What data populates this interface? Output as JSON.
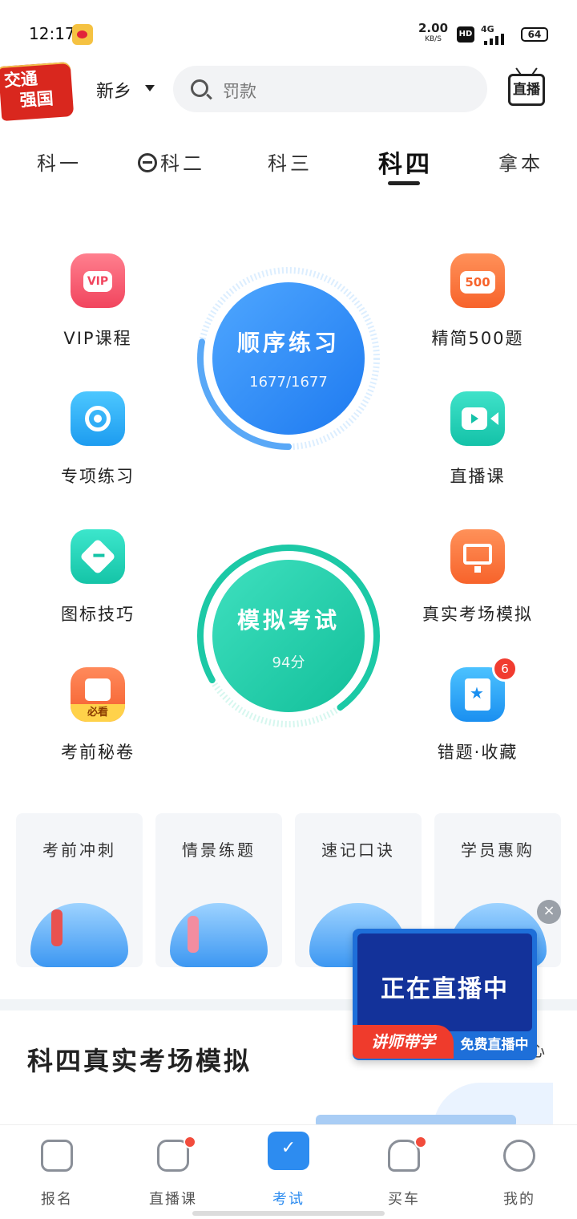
{
  "status": {
    "time": "12:17",
    "speed": "2.00",
    "speed_unit": "KB/S",
    "hd": "HD",
    "net": "4G",
    "battery": "64"
  },
  "header": {
    "badge_line1": "交通",
    "badge_line2": "强国",
    "city": "新乡",
    "search_placeholder": "罚款",
    "live_label": "直播"
  },
  "tabs": [
    {
      "label": "科一"
    },
    {
      "label": "科二"
    },
    {
      "label": "科三"
    },
    {
      "label": "科四",
      "active": true
    },
    {
      "label": "拿本"
    }
  ],
  "grid": {
    "vip": "VIP课程",
    "vip_icon": "VIP",
    "jingjian": "精简500题",
    "jingjian_icon": "500",
    "zhuanxiang": "专项练习",
    "zhibo": "直播课",
    "tubiao": "图标技巧",
    "zhenshi": "真实考场模拟",
    "miju": "考前秘卷",
    "miju_icon": "必看",
    "cuoti": "错题·收藏",
    "cuoti_badge": "6"
  },
  "sequence": {
    "title": "顺序练习",
    "progress": "1677/1677",
    "fraction": 1.0
  },
  "mock": {
    "title": "模拟考试",
    "score": "94分",
    "fraction": 0.94
  },
  "cards": [
    {
      "title": "考前冲刺"
    },
    {
      "title": "情景练题"
    },
    {
      "title": "速记口诀"
    },
    {
      "title": "学员惠购"
    }
  ],
  "section": {
    "title": "科四真实考场模拟",
    "more": "心"
  },
  "float_live": {
    "main": "正在直播中",
    "left": "讲师带学",
    "right": "免费直播中",
    "close": "×"
  },
  "colors": {
    "accent": "#2d8cf0",
    "teal": "#1cc9a6",
    "red": "#f24c3c"
  },
  "nav": [
    {
      "label": "报名"
    },
    {
      "label": "直播课"
    },
    {
      "label": "考试"
    },
    {
      "label": "买车"
    },
    {
      "label": "我的"
    }
  ]
}
